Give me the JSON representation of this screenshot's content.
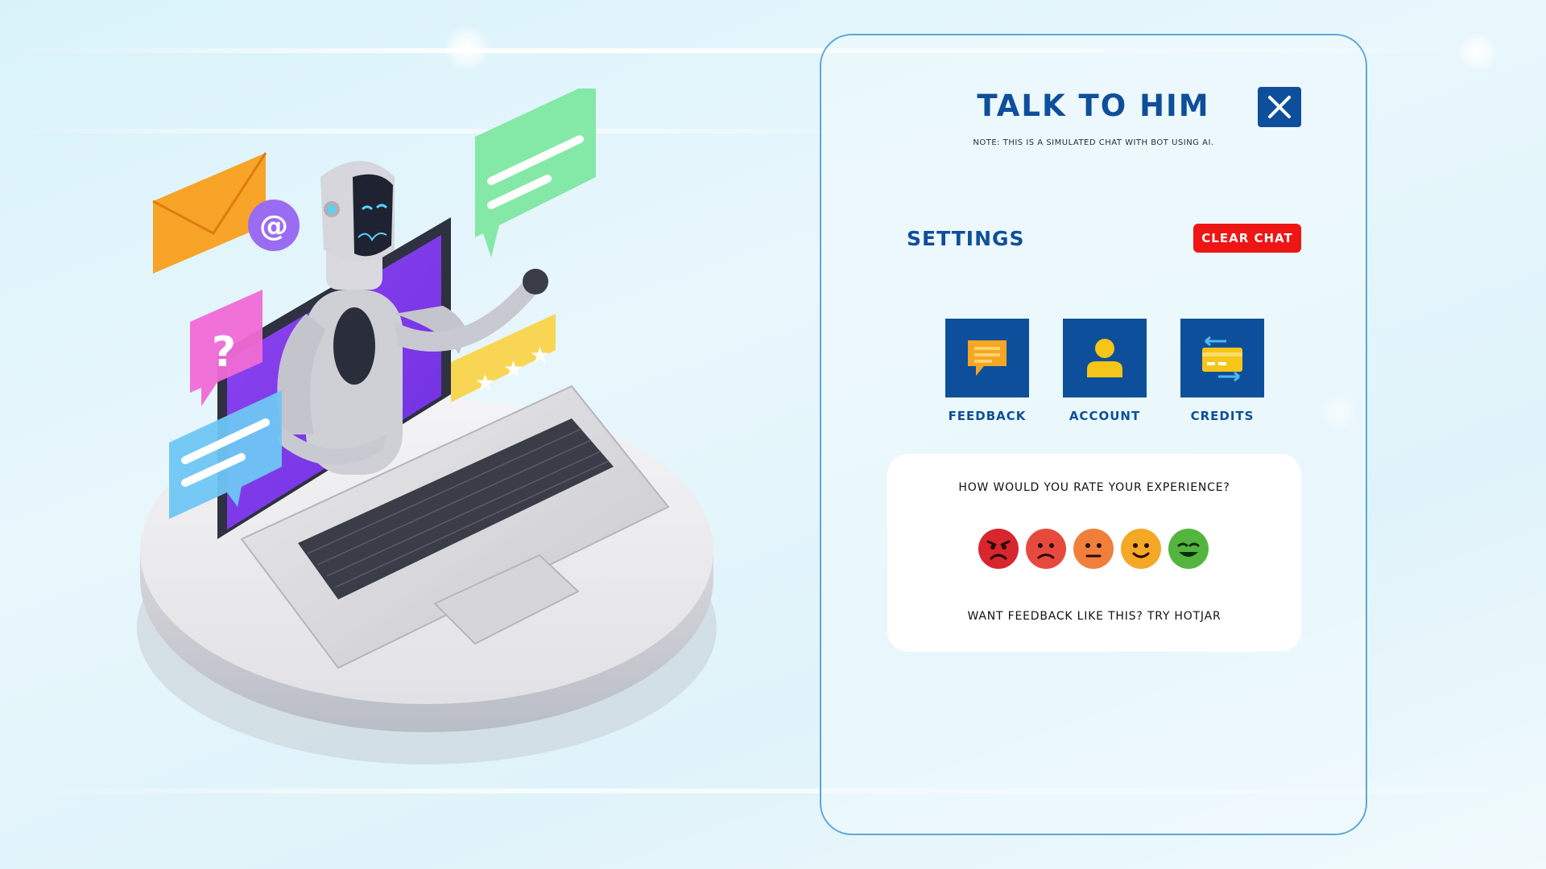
{
  "panel": {
    "title": "TALK TO HIM",
    "note": "NOTE: THIS IS A SIMULATED CHAT WITH BOT USING AI.",
    "close_icon": "close-icon"
  },
  "settings": {
    "title": "SETTINGS",
    "clear_label": "CLEAR CHAT",
    "tiles": [
      {
        "label": "FEEDBACK",
        "icon": "feedback-chat-icon"
      },
      {
        "label": "ACCOUNT",
        "icon": "account-user-icon"
      },
      {
        "label": "CREDITS",
        "icon": "credits-card-icon"
      }
    ]
  },
  "rating": {
    "question": "HOW WOULD YOU RATE YOUR EXPERIENCE?",
    "faces": [
      "angry-face",
      "sad-face",
      "neutral-face",
      "happy-face",
      "very-happy-face"
    ],
    "footer": "WANT FEEDBACK LIKE THIS? TRY HOTJAR"
  },
  "colors": {
    "brand_blue": "#0e4f9b",
    "clear_red": "#ee1515",
    "tile_accent": "#f5c518",
    "face_angry": "#d8262f",
    "face_sad": "#e64a3c",
    "face_neutral": "#ef7f3a",
    "face_happy": "#f4a826",
    "face_very_happy": "#54b53e"
  }
}
